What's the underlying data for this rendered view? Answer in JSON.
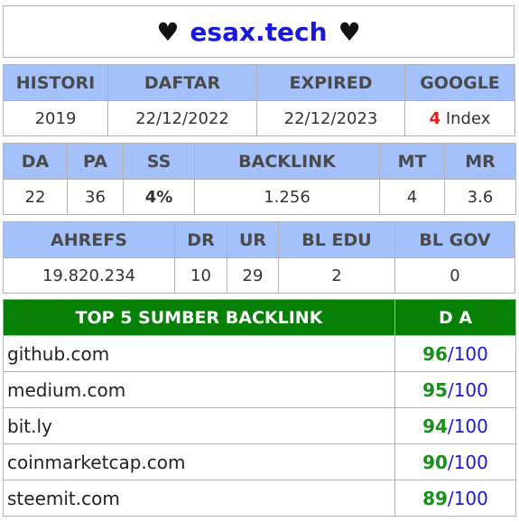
{
  "title": {
    "heart_left": "♥",
    "site": "esax.tech",
    "heart_right": "♥"
  },
  "table1": {
    "headers": [
      "HISTORI",
      "DAFTAR",
      "EXPIRED",
      "GOOGLE"
    ],
    "histori": "2019",
    "daftar": "22/12/2022",
    "expired": "22/12/2023",
    "google_count": "4",
    "google_label": "Index"
  },
  "table2": {
    "headers": [
      "DA",
      "PA",
      "SS",
      "BACKLINK",
      "MT",
      "MR"
    ],
    "values": [
      "22",
      "36",
      "4%",
      "1.256",
      "4",
      "3.6"
    ]
  },
  "table3": {
    "headers": [
      "AHREFS",
      "DR",
      "UR",
      "BL EDU",
      "BL GOV"
    ],
    "values": [
      "19.820.234",
      "10",
      "29",
      "2",
      "0"
    ]
  },
  "top_backlinks": {
    "headers": [
      "TOP 5 SUMBER BACKLINK",
      "D A"
    ],
    "max": "/100",
    "rows": [
      {
        "domain": "github.com",
        "da": "96"
      },
      {
        "domain": "medium.com",
        "da": "95"
      },
      {
        "domain": "bit.ly",
        "da": "94"
      },
      {
        "domain": "coinmarketcap.com",
        "da": "90"
      },
      {
        "domain": "steemit.com",
        "da": "89"
      }
    ]
  },
  "colors": {
    "header_bg": "#a4c1fc",
    "top_header_bg": "#078007",
    "site_blue": "#1a1ad6",
    "good_green": "#179117",
    "alert_red": "#e01b1b"
  }
}
